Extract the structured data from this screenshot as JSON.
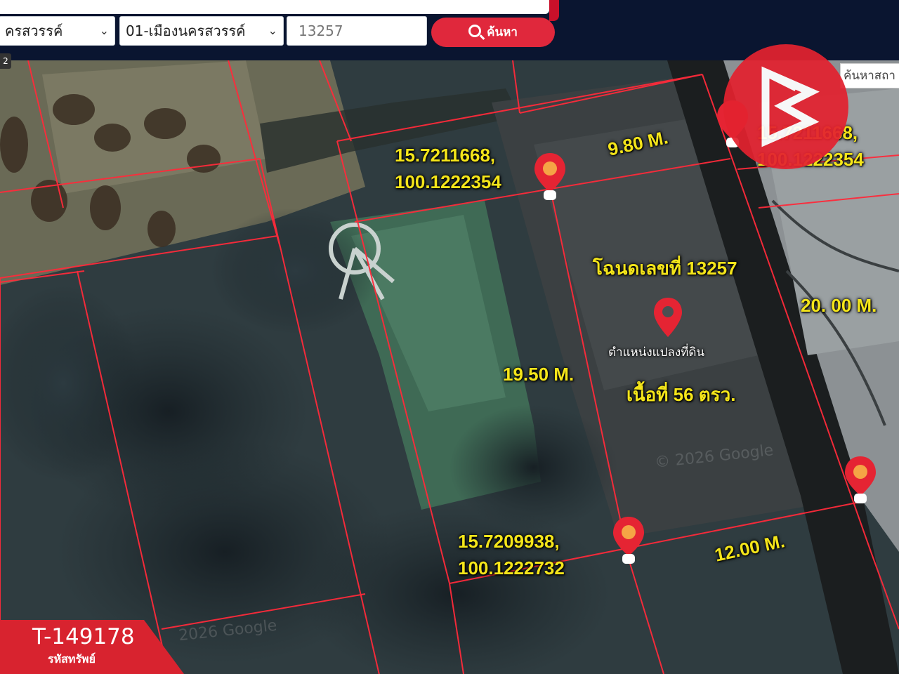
{
  "search_bar": {
    "province_value": "ครสวรรค์",
    "district_value": "01-เมืองนครสวรรค์",
    "deed_input_value": "13257",
    "search_button_label": "ค้นหา"
  },
  "map": {
    "zoom_badge": "2",
    "place_search_placeholder": "ค้นหาสถา",
    "coordinates": [
      {
        "lat": "15.7211668,",
        "lng": "100.1222354"
      },
      {
        "lat": "15.7211668,",
        "lng": "100.1222354"
      },
      {
        "lat": "15.7209938,",
        "lng": "100.1222732"
      }
    ],
    "dimensions": {
      "top": "9.80 M.",
      "right": "20. 00 M.",
      "left": "19.50 M.",
      "bottom": "12.00 M."
    },
    "deed_label": "โฉนดเลขที่ 13257",
    "parcel_position_label": "ตำแหน่งแปลงที่ดิน",
    "area_label": "เนื้อที่ 56 ตรว.",
    "watermark": "© 2026 Google",
    "watermark_bottom": "2026 Google"
  },
  "asset": {
    "code": "T-149178",
    "caption": "รหัสทรัพย์"
  },
  "colors": {
    "header_bg": "#0a1530",
    "accent_red": "#e0283c",
    "label_yellow": "#f4e51a",
    "parcel_line": "#ff2a3a"
  },
  "icons": [
    "search-icon",
    "chevron-down-icon",
    "map-pin-icon",
    "brand-logo"
  ]
}
